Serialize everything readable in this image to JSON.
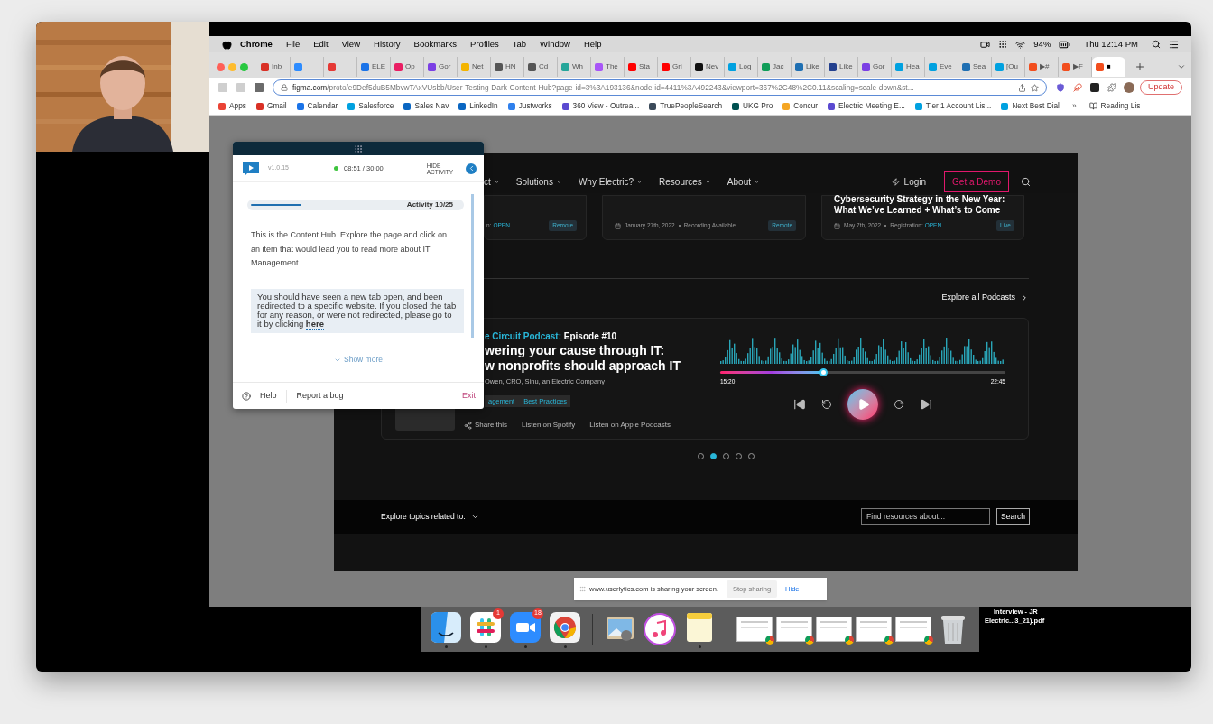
{
  "menu_bar": {
    "app": "Chrome",
    "items": [
      "File",
      "Edit",
      "View",
      "History",
      "Bookmarks",
      "Profiles",
      "Tab",
      "Window",
      "Help"
    ],
    "battery": "94%",
    "clock": "Thu 12:14 PM"
  },
  "browser": {
    "tabs": [
      {
        "title": "Inb",
        "color": "#d93025",
        "selected": false
      },
      {
        "color": "#2d8cff",
        "selected": false
      },
      {
        "color": "#e53935",
        "selected": false
      },
      {
        "title": "ELE",
        "color": "#1a73e8",
        "selected": false
      },
      {
        "title": "Op",
        "color": "#e91e63",
        "selected": false
      },
      {
        "title": "Gor",
        "color": "#7b3fe4",
        "selected": false
      },
      {
        "title": "Net",
        "color": "#f4b400",
        "selected": false
      },
      {
        "title": "HN",
        "color": "#555555",
        "selected": false
      },
      {
        "title": "Cd",
        "color": "#555555",
        "selected": false
      },
      {
        "title": "Wh",
        "color": "#26a69a",
        "selected": false
      },
      {
        "title": "The",
        "color": "#a855f7",
        "selected": false
      },
      {
        "title": "Sta",
        "color": "#ff0000",
        "selected": false
      },
      {
        "title": "Gri",
        "color": "#ff0000",
        "selected": false
      },
      {
        "title": "Nev",
        "color": "#111111",
        "selected": false
      },
      {
        "title": "Log",
        "color": "#00a1e0",
        "selected": false
      },
      {
        "title": "Jac",
        "color": "#0f9d58",
        "selected": false
      },
      {
        "title": "Like",
        "color": "#1f6fb2",
        "selected": false
      },
      {
        "title": "Like",
        "color": "#23408e",
        "selected": false
      },
      {
        "title": "Gor",
        "color": "#7b3fe4",
        "selected": false
      },
      {
        "title": "Hea",
        "color": "#00a1e0",
        "selected": false
      },
      {
        "title": "Eve",
        "color": "#00a1e0",
        "selected": false
      },
      {
        "title": "Sea",
        "color": "#1f6fb2",
        "selected": false
      },
      {
        "title": "[Ou",
        "color": "#00a1e0",
        "selected": false
      },
      {
        "title": "▶#",
        "color": "#f24e1e",
        "selected": false
      },
      {
        "title": "▶F",
        "color": "#f24e1e",
        "selected": false
      },
      {
        "title": "■",
        "color": "#f24e1e",
        "selected": true
      }
    ],
    "url_domain": "figma.com",
    "url_path": "/proto/e9Def5duB5MbvwTAxVUsbb/User-Testing-Dark-Content-Hub?page-id=3%3A193136&node-id=4411%3A492243&viewport=367%2C48%2C0.11&scaling=scale-down&st...",
    "update_button": "Update",
    "bookmarks": [
      {
        "label": "Apps",
        "color": "#ea4335"
      },
      {
        "label": "Gmail",
        "color": "#d93025"
      },
      {
        "label": "Calendar",
        "color": "#1a73e8"
      },
      {
        "label": "Salesforce",
        "color": "#00a1e0"
      },
      {
        "label": "Sales Nav",
        "color": "#0a66c2"
      },
      {
        "label": "LinkedIn",
        "color": "#0a66c2"
      },
      {
        "label": "Justworks",
        "color": "#2f80ed"
      },
      {
        "label": "360 View - Outrea...",
        "color": "#5b4ad1"
      },
      {
        "label": "TruePeopleSearch",
        "color": "#3b4a5a"
      },
      {
        "label": "UKG Pro",
        "color": "#005151"
      },
      {
        "label": "Concur",
        "color": "#f5a623"
      },
      {
        "label": "Electric Meeting E...",
        "color": "#5b4ad1"
      },
      {
        "label": "Tier 1 Account Lis...",
        "color": "#00a1e0"
      },
      {
        "label": "Next Best Dial",
        "color": "#00a1e0"
      }
    ],
    "bookmarks_more": "»",
    "reading_list": "Reading Lis"
  },
  "website": {
    "nav": {
      "items": [
        "ct",
        "Solutions",
        "Why Electric?",
        "Resources",
        "About"
      ],
      "login": "Login",
      "cta": "Get a Demo"
    },
    "events": [
      {
        "meta": "n:",
        "status": "OPEN",
        "badge": "Remote"
      },
      {
        "date": "January 27th, 2022",
        "meta": "Recording Available",
        "badge": "Remote"
      },
      {
        "title_lines": [
          "Cybersecurity Strategy in the New Year:",
          "What We’ve Learned + What’s to Come"
        ],
        "date": "May 7th, 2022",
        "meta": "Registration:",
        "status": "OPEN",
        "badge": "Live"
      }
    ],
    "podcasts_link": "Explore all Podcasts",
    "podcast": {
      "series": "e Circuit Podcast:",
      "episode": "Episode #10",
      "title_lines": [
        "wering your cause through IT:",
        "w nonprofits should approach IT"
      ],
      "author": "Owen, CRO, Sinu, an Electric Company",
      "tags": [
        "agement",
        "Best Practices"
      ],
      "actions": [
        "Share this",
        "Listen on Spotify",
        "Listen on Apple Podcasts"
      ],
      "elapsed": "15:20",
      "duration": "22:45",
      "level": 0.36
    },
    "carousel_dots": [
      {
        "selected": false
      },
      {
        "selected": true
      },
      {
        "selected": false
      },
      {
        "selected": false
      },
      {
        "selected": false
      }
    ],
    "footer": {
      "topics_label": "Explore topics related to:",
      "search_placeholder": "Find resources about...",
      "search_button": "Search"
    }
  },
  "panel": {
    "version": "v1.0.15",
    "timer": "08:51 / 30:00",
    "hide_label": [
      "HIDE",
      "ACTIVITY"
    ],
    "activity": {
      "label": "Activity 10/25",
      "level": 0.24
    },
    "instructions": "This is the Content Hub. Explore the page and click on an item that would lead you to read more about IT Management.",
    "notice": "You should have seen a new tab open, and been redirected to a specific website. If you closed the tab for any reason, or were not redirected, please go to it by clicking",
    "notice_link": "here",
    "show_more": "Show more",
    "help": "Help",
    "report": "Report a bug",
    "exit": "Exit"
  },
  "share_bar": {
    "message": "www.userlytics.com is sharing your screen.",
    "stop": "Stop sharing",
    "hide": "Hide"
  },
  "dock": {
    "items": [
      {
        "kind": "finder",
        "running": true
      },
      {
        "kind": "slack",
        "badge": "1",
        "running": true
      },
      {
        "kind": "zoom",
        "badge": "18",
        "running": true
      },
      {
        "kind": "chrome",
        "running": true
      },
      {
        "kind": "separator"
      },
      {
        "kind": "preview",
        "running": false
      },
      {
        "kind": "music",
        "running": false
      },
      {
        "kind": "notes",
        "running": true
      },
      {
        "kind": "separator"
      },
      {
        "kind": "window"
      },
      {
        "kind": "window"
      },
      {
        "kind": "window"
      },
      {
        "kind": "window"
      },
      {
        "kind": "window"
      },
      {
        "kind": "trash",
        "running": false
      }
    ]
  },
  "desktop_file": {
    "lines": [
      "Interview - JR",
      "Electric...3_21).pdf"
    ]
  }
}
